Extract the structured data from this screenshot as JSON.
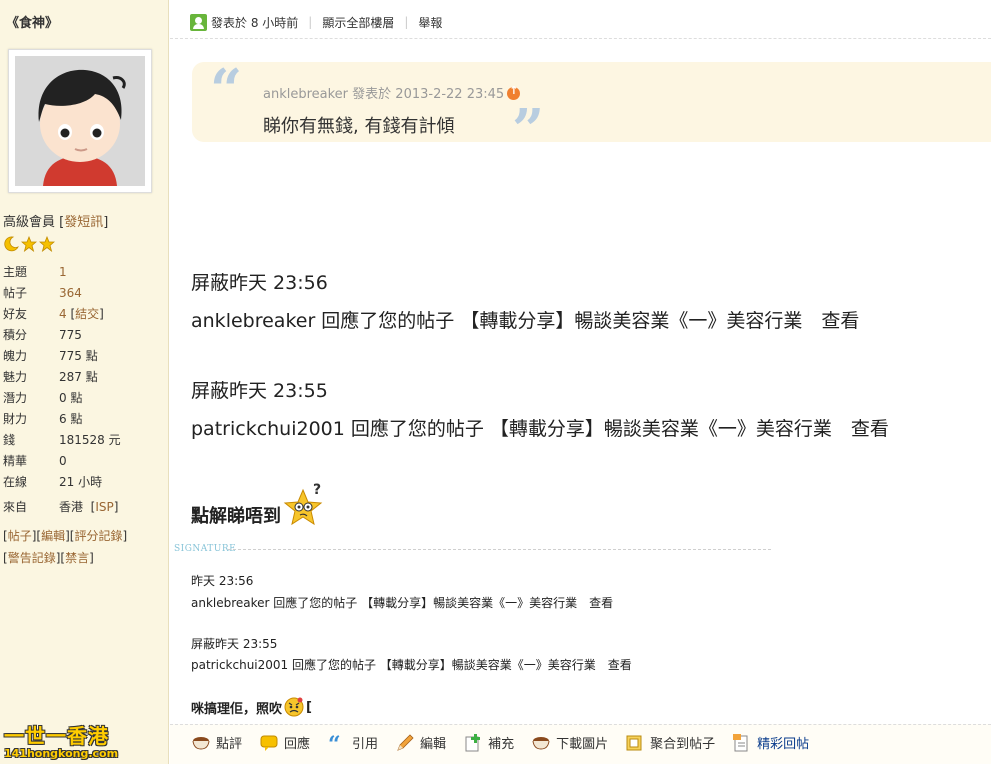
{
  "sidebar": {
    "username": "《食神》",
    "rank_text": "高級會員",
    "pm_link": "發短訊",
    "stats": [
      {
        "label": "主題",
        "value": "1",
        "link": true
      },
      {
        "label": "帖子",
        "value": "364",
        "link": true
      },
      {
        "label": "好友",
        "value": "4",
        "link": true,
        "extra": "結交"
      },
      {
        "label": "積分",
        "value": "775",
        "link": false
      },
      {
        "label": "魄力",
        "value": "775 點",
        "link": false
      },
      {
        "label": "魅力",
        "value": "287 點",
        "link": false
      },
      {
        "label": "潛力",
        "value": "0 點",
        "link": false
      },
      {
        "label": "財力",
        "value": "6 點",
        "link": false
      },
      {
        "label": "錢",
        "value": "181528 元",
        "link": false
      },
      {
        "label": "精華",
        "value": "0",
        "link": false
      },
      {
        "label": "在線",
        "value": "21 小時",
        "link": false
      }
    ],
    "from_label": "來自",
    "from_value": "香港",
    "isp": "ISP",
    "links_row1": [
      "帖子",
      "編輯",
      "評分記錄"
    ],
    "links_row2": [
      "警告記錄",
      "禁言"
    ],
    "logo_line1": "一世一香港",
    "logo_line2": "141hongkong.com"
  },
  "postinfo": {
    "posted": "發表於 8 小時前",
    "show_all": "顯示全部樓層",
    "report": "舉報"
  },
  "quote": {
    "author": "anklebreaker",
    "posted_at": "發表於 2013-2-22 23:45",
    "text": "睇你有無錢, 有錢有計傾"
  },
  "notifications": [
    {
      "time": "屏蔽昨天 23:56",
      "message": "anklebreaker 回應了您的帖子 【轉載分享】暢談美容業《一》美容行業　查看"
    },
    {
      "time": "屏蔽昨天 23:55",
      "message": "patrickchui2001 回應了您的帖子 【轉載分享】暢談美容業《一》美容行業　查看"
    }
  ],
  "why_text": "點解睇唔到",
  "signature": {
    "label": "SIGNATURE",
    "items": [
      {
        "time": "昨天 23:56",
        "message": "anklebreaker 回應了您的帖子 【轉載分享】暢談美容業《一》美容行業　查看"
      },
      {
        "time": "屏蔽昨天 23:55",
        "message": "patrickchui2001 回應了您的帖子 【轉載分享】暢談美容業《一》美容行業　查看"
      }
    ],
    "closing": "咪搞理佢，照吹",
    "closing_tail": "["
  },
  "actions": [
    {
      "label": "點評",
      "icon": "cup-icon"
    },
    {
      "label": "回應",
      "icon": "speech-bubble-icon"
    },
    {
      "label": "引用",
      "icon": "quote-icon"
    },
    {
      "label": "編輯",
      "icon": "pencil-icon"
    },
    {
      "label": "補充",
      "icon": "add-note-icon"
    },
    {
      "label": "下載圖片",
      "icon": "download-image-icon"
    },
    {
      "label": "聚合到帖子",
      "icon": "merge-icon"
    },
    {
      "label": "精彩回帖",
      "icon": "featured-reply-icon"
    }
  ],
  "colors": {
    "sidebar_bg": "#fbf6e1",
    "link": "#996633",
    "quote_bg": "#fdf6e2",
    "quote_mark": "#b8cde0"
  }
}
